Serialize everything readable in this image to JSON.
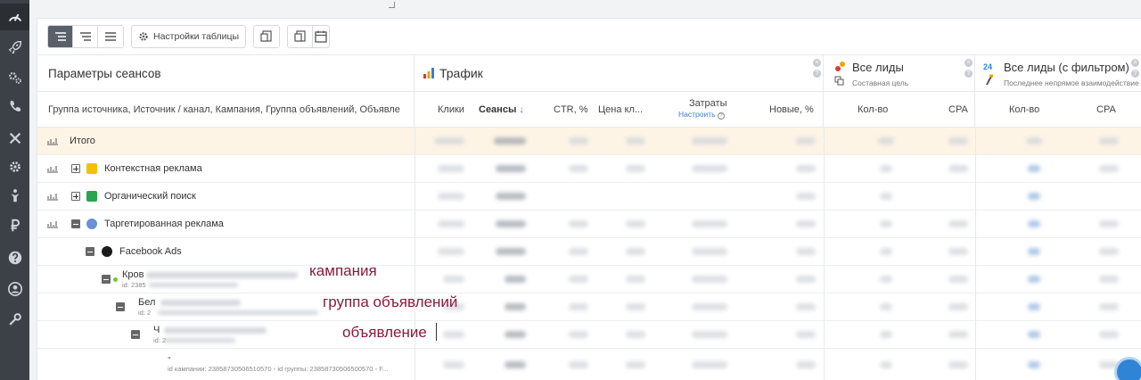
{
  "toolbar": {
    "settings_label": "Настройки таблицы"
  },
  "header": {
    "params_title": "Параметры сеансов",
    "params_subtitle": "Группа источника, Источник / канал, Кампания, Группа объявлений, Объявле",
    "traffic_title": "Трафик",
    "leads_title": "Все лиды",
    "leads_subtitle": "Составная цель",
    "leads2_title": "Все лиды (с фильтром)",
    "leads2_subtitle": "Последнее непрямое взаимодействие",
    "columns": {
      "clicks": "Клики",
      "sessions": "Сеансы",
      "sessions_sort": "↓",
      "ctr": "CTR, %",
      "price": "Цена кл...",
      "costs": "Затраты",
      "costs_link": "Настроить",
      "new": "Новые, %",
      "leads_count": "Кол-во",
      "leads_cpa": "CPA",
      "leads2_count": "Кол-во",
      "leads2_cpa": "CPA"
    }
  },
  "rows": [
    {
      "label": "Итого"
    },
    {
      "label": "Контекстная реклама"
    },
    {
      "label": "Органический поиск"
    },
    {
      "label": "Таргетированная реклама"
    },
    {
      "label": "Facebook Ads"
    },
    {
      "label": "Кров",
      "id": "id: 2385"
    },
    {
      "label": "Бел",
      "id": "id: 2"
    },
    {
      "label": "Ч",
      "id": "id: 2"
    },
    {
      "label": "-",
      "id_campaign": "id кампании: 23858730506510570",
      "id_group": "id группы: 23858730506500570",
      "id_tail": "F..."
    }
  ],
  "annotations": {
    "campaign": "кампания",
    "ad_group": "группа объявлений",
    "ad": "объявление"
  },
  "colors": {
    "accent": "#3b7dd8",
    "annotation": "#8b1a3a",
    "total_row": "#fdf4e6",
    "rail": "#3c4047"
  }
}
